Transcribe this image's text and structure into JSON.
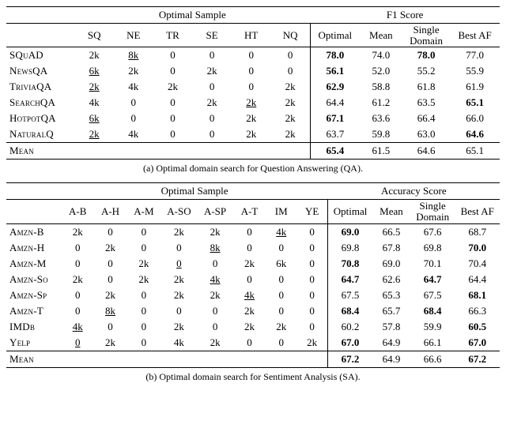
{
  "tableA": {
    "group_labels": {
      "left": "Optimal Sample",
      "right": "F1 Score"
    },
    "sample_cols": [
      "SQ",
      "NE",
      "TR",
      "SE",
      "HT",
      "NQ"
    ],
    "score_cols": [
      "Optimal",
      "Mean",
      "Single\nDomain",
      "Best AF"
    ],
    "rows": [
      {
        "name": "SQuAD",
        "samples": [
          "2k",
          "8k",
          "0",
          "0",
          "0",
          "0"
        ],
        "samples_u": [
          0,
          1,
          0,
          0,
          0,
          0
        ],
        "scores": [
          "78.0",
          "74.0",
          "78.0",
          "77.0"
        ],
        "scores_b": [
          1,
          0,
          1,
          0
        ]
      },
      {
        "name": "NewsQA",
        "samples": [
          "6k",
          "2k",
          "0",
          "2k",
          "0",
          "0"
        ],
        "samples_u": [
          1,
          0,
          0,
          0,
          0,
          0
        ],
        "scores": [
          "56.1",
          "52.0",
          "55.2",
          "55.9"
        ],
        "scores_b": [
          1,
          0,
          0,
          0
        ]
      },
      {
        "name": "TriviaQA",
        "samples": [
          "2k",
          "4k",
          "2k",
          "0",
          "0",
          "2k"
        ],
        "samples_u": [
          1,
          0,
          0,
          0,
          0,
          0
        ],
        "scores": [
          "62.9",
          "58.8",
          "61.8",
          "61.9"
        ],
        "scores_b": [
          1,
          0,
          0,
          0
        ]
      },
      {
        "name": "SearchQA",
        "samples": [
          "4k",
          "0",
          "0",
          "2k",
          "2k",
          "2k"
        ],
        "samples_u": [
          0,
          0,
          0,
          0,
          1,
          0
        ],
        "scores": [
          "64.4",
          "61.2",
          "63.5",
          "65.1"
        ],
        "scores_b": [
          0,
          0,
          0,
          1
        ]
      },
      {
        "name": "HotpotQA",
        "samples": [
          "6k",
          "0",
          "0",
          "0",
          "2k",
          "2k"
        ],
        "samples_u": [
          1,
          0,
          0,
          0,
          0,
          0
        ],
        "scores": [
          "67.1",
          "63.6",
          "66.4",
          "66.0"
        ],
        "scores_b": [
          1,
          0,
          0,
          0
        ]
      },
      {
        "name": "NaturalQ",
        "samples": [
          "2k",
          "4k",
          "0",
          "0",
          "2k",
          "2k"
        ],
        "samples_u": [
          1,
          0,
          0,
          0,
          0,
          0
        ],
        "scores": [
          "63.7",
          "59.8",
          "63.0",
          "64.6"
        ],
        "scores_b": [
          0,
          0,
          0,
          1
        ]
      }
    ],
    "mean": {
      "name": "Mean",
      "scores": [
        "65.4",
        "61.5",
        "64.6",
        "65.1"
      ],
      "scores_b": [
        1,
        0,
        0,
        0
      ]
    },
    "caption": "(a) Optimal domain search for Question Answering (QA)."
  },
  "tableB": {
    "group_labels": {
      "left": "Optimal Sample",
      "right": "Accuracy Score"
    },
    "sample_cols": [
      "A-B",
      "A-H",
      "A-M",
      "A-SO",
      "A-SP",
      "A-T",
      "IM",
      "YE"
    ],
    "score_cols": [
      "Optimal",
      "Mean",
      "Single\nDomain",
      "Best AF"
    ],
    "rows": [
      {
        "name": "Amzn-B",
        "samples": [
          "2k",
          "0",
          "0",
          "2k",
          "2k",
          "0",
          "4k",
          "0"
        ],
        "samples_u": [
          0,
          0,
          0,
          0,
          0,
          0,
          1,
          0
        ],
        "scores": [
          "69.0",
          "66.5",
          "67.6",
          "68.7"
        ],
        "scores_b": [
          1,
          0,
          0,
          0
        ]
      },
      {
        "name": "Amzn-H",
        "samples": [
          "0",
          "2k",
          "0",
          "0",
          "8k",
          "0",
          "0",
          "0"
        ],
        "samples_u": [
          0,
          0,
          0,
          0,
          1,
          0,
          0,
          0
        ],
        "scores": [
          "69.8",
          "67.8",
          "69.8",
          "70.0"
        ],
        "scores_b": [
          0,
          0,
          0,
          1
        ]
      },
      {
        "name": "Amzn-M",
        "samples": [
          "0",
          "0",
          "2k",
          "0",
          "0",
          "2k",
          "6k",
          "0"
        ],
        "samples_u": [
          0,
          0,
          0,
          1,
          0,
          0,
          0,
          0
        ],
        "scores": [
          "70.8",
          "69.0",
          "70.1",
          "70.4"
        ],
        "scores_b": [
          1,
          0,
          0,
          0
        ]
      },
      {
        "name": "Amzn-So",
        "samples": [
          "2k",
          "0",
          "2k",
          "2k",
          "4k",
          "0",
          "0",
          "0"
        ],
        "samples_u": [
          0,
          0,
          0,
          0,
          1,
          0,
          0,
          0
        ],
        "scores": [
          "64.7",
          "62.6",
          "64.7",
          "64.4"
        ],
        "scores_b": [
          1,
          0,
          1,
          0
        ]
      },
      {
        "name": "Amzn-Sp",
        "samples": [
          "0",
          "2k",
          "0",
          "2k",
          "2k",
          "4k",
          "0",
          "0"
        ],
        "samples_u": [
          0,
          0,
          0,
          0,
          0,
          1,
          0,
          0
        ],
        "scores": [
          "67.5",
          "65.3",
          "67.5",
          "68.1"
        ],
        "scores_b": [
          0,
          0,
          0,
          1
        ]
      },
      {
        "name": "Amzn-T",
        "samples": [
          "0",
          "8k",
          "0",
          "0",
          "0",
          "2k",
          "0",
          "0"
        ],
        "samples_u": [
          0,
          1,
          0,
          0,
          0,
          0,
          0,
          0
        ],
        "scores": [
          "68.4",
          "65.7",
          "68.4",
          "66.3"
        ],
        "scores_b": [
          1,
          0,
          1,
          0
        ]
      },
      {
        "name": "IMDb",
        "samples": [
          "4k",
          "0",
          "0",
          "2k",
          "0",
          "2k",
          "2k",
          "0"
        ],
        "samples_u": [
          1,
          0,
          0,
          0,
          0,
          0,
          0,
          0
        ],
        "scores": [
          "60.2",
          "57.8",
          "59.9",
          "60.5"
        ],
        "scores_b": [
          0,
          0,
          0,
          1
        ]
      },
      {
        "name": "Yelp",
        "samples": [
          "0",
          "2k",
          "0",
          "4k",
          "2k",
          "0",
          "0",
          "2k"
        ],
        "samples_u": [
          1,
          0,
          0,
          0,
          0,
          0,
          0,
          0
        ],
        "scores": [
          "67.0",
          "64.9",
          "66.1",
          "67.0"
        ],
        "scores_b": [
          1,
          0,
          0,
          1
        ]
      }
    ],
    "mean": {
      "name": "Mean",
      "scores": [
        "67.2",
        "64.9",
        "66.6",
        "67.2"
      ],
      "scores_b": [
        1,
        0,
        0,
        1
      ]
    },
    "caption": "(b) Optimal domain search for Sentiment Analysis (SA)."
  },
  "chart_data": [
    {
      "type": "table",
      "title": "Optimal domain search for Question Answering (QA)",
      "row_labels": [
        "SQuAD",
        "NewsQA",
        "TriviaQA",
        "SearchQA",
        "HotpotQA",
        "NaturalQ",
        "Mean"
      ],
      "sample_columns": [
        "SQ",
        "NE",
        "TR",
        "SE",
        "HT",
        "NQ"
      ],
      "samples": [
        [
          2000,
          8000,
          0,
          0,
          0,
          0
        ],
        [
          6000,
          2000,
          0,
          2000,
          0,
          0
        ],
        [
          2000,
          4000,
          2000,
          0,
          0,
          2000
        ],
        [
          4000,
          0,
          0,
          2000,
          2000,
          2000
        ],
        [
          6000,
          0,
          0,
          0,
          2000,
          2000
        ],
        [
          2000,
          4000,
          0,
          0,
          2000,
          2000
        ]
      ],
      "score_columns": [
        "Optimal",
        "Mean",
        "Single Domain",
        "Best AF"
      ],
      "scores": [
        [
          78.0,
          74.0,
          78.0,
          77.0
        ],
        [
          56.1,
          52.0,
          55.2,
          55.9
        ],
        [
          62.9,
          58.8,
          61.8,
          61.9
        ],
        [
          64.4,
          61.2,
          63.5,
          65.1
        ],
        [
          67.1,
          63.6,
          66.4,
          66.0
        ],
        [
          63.7,
          59.8,
          63.0,
          64.6
        ],
        [
          65.4,
          61.5,
          64.6,
          65.1
        ]
      ]
    },
    {
      "type": "table",
      "title": "Optimal domain search for Sentiment Analysis (SA)",
      "row_labels": [
        "Amzn-B",
        "Amzn-H",
        "Amzn-M",
        "Amzn-So",
        "Amzn-Sp",
        "Amzn-T",
        "IMDb",
        "Yelp",
        "Mean"
      ],
      "sample_columns": [
        "A-B",
        "A-H",
        "A-M",
        "A-SO",
        "A-SP",
        "A-T",
        "IM",
        "YE"
      ],
      "samples": [
        [
          2000,
          0,
          0,
          2000,
          2000,
          0,
          4000,
          0
        ],
        [
          0,
          2000,
          0,
          0,
          8000,
          0,
          0,
          0
        ],
        [
          0,
          0,
          2000,
          0,
          0,
          2000,
          6000,
          0
        ],
        [
          2000,
          0,
          2000,
          2000,
          4000,
          0,
          0,
          0
        ],
        [
          0,
          2000,
          0,
          2000,
          2000,
          4000,
          0,
          0
        ],
        [
          0,
          8000,
          0,
          0,
          0,
          2000,
          0,
          0
        ],
        [
          4000,
          0,
          0,
          2000,
          0,
          2000,
          2000,
          0
        ],
        [
          0,
          2000,
          0,
          4000,
          2000,
          0,
          0,
          2000
        ]
      ],
      "score_columns": [
        "Optimal",
        "Mean",
        "Single Domain",
        "Best AF"
      ],
      "scores": [
        [
          69.0,
          66.5,
          67.6,
          68.7
        ],
        [
          69.8,
          67.8,
          69.8,
          70.0
        ],
        [
          70.8,
          69.0,
          70.1,
          70.4
        ],
        [
          64.7,
          62.6,
          64.7,
          64.4
        ],
        [
          67.5,
          65.3,
          67.5,
          68.1
        ],
        [
          68.4,
          65.7,
          68.4,
          66.3
        ],
        [
          60.2,
          57.8,
          59.9,
          60.5
        ],
        [
          67.0,
          64.9,
          66.1,
          67.0
        ],
        [
          67.2,
          64.9,
          66.6,
          67.2
        ]
      ]
    }
  ]
}
